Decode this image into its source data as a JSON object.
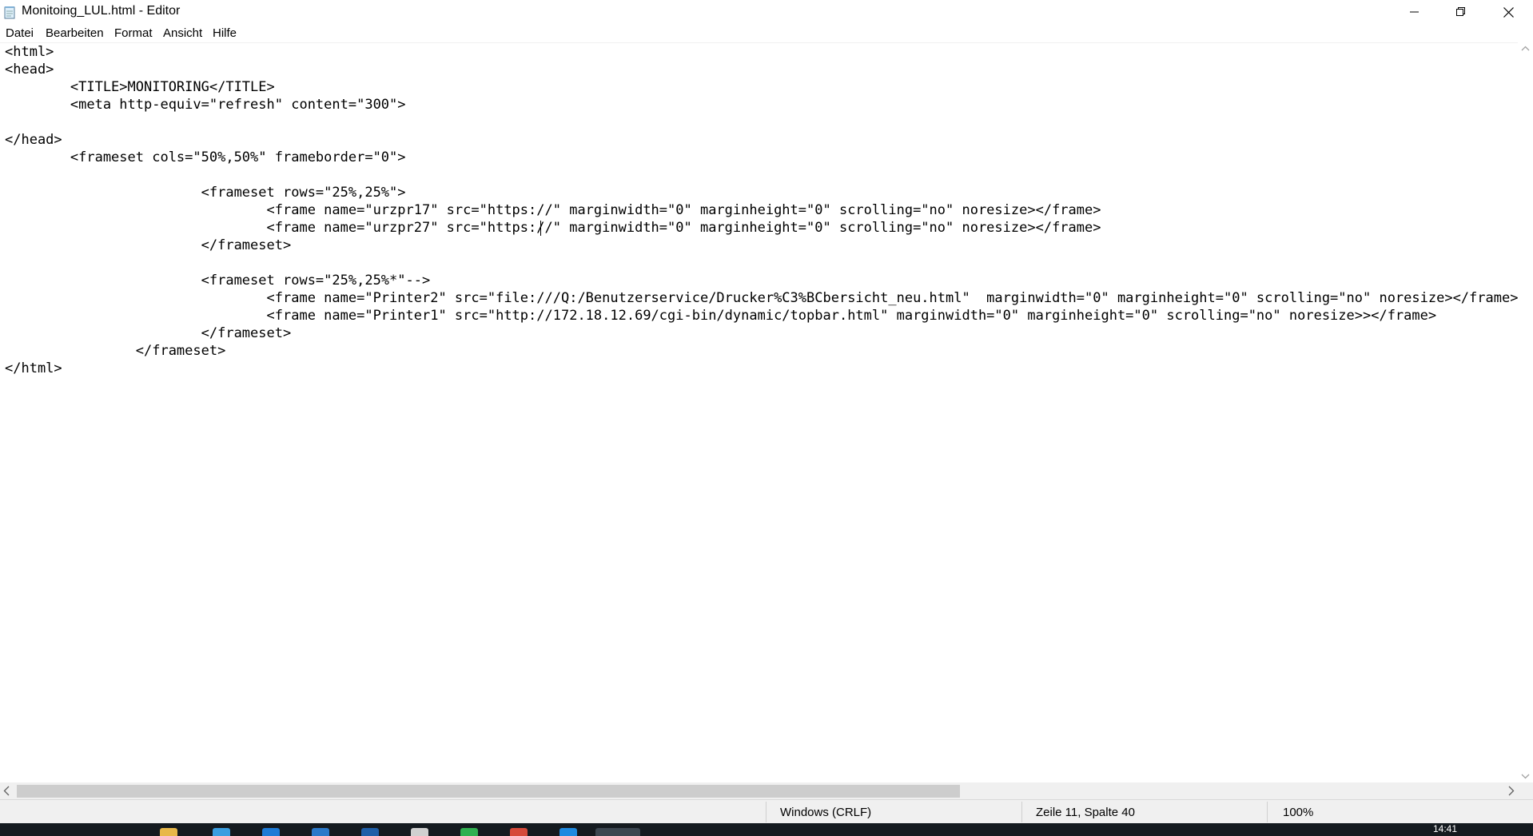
{
  "window": {
    "title": "Monitoing_LUL.html - Editor"
  },
  "menu": {
    "items": [
      "Datei",
      "Bearbeiten",
      "Format",
      "Ansicht",
      "Hilfe"
    ]
  },
  "editor": {
    "lines": [
      "<html>",
      "<head>",
      "        <TITLE>MONITORING</TITLE>",
      "        <meta http-equiv=\"refresh\" content=\"300\">",
      "",
      "</head>",
      "        <frameset cols=\"50%,50%\" frameborder=\"0\">",
      "",
      "                        <frameset rows=\"25%,25%\">",
      "                                <frame name=\"urzpr17\" src=\"https://\" marginwidth=\"0\" marginheight=\"0\" scrolling=\"no\" noresize></frame>",
      "                                <frame name=\"urzpr27\" src=\"https://\" marginwidth=\"0\" marginheight=\"0\" scrolling=\"no\" noresize></frame>",
      "                        </frameset>",
      "",
      "                        <frameset rows=\"25%,25%*\"-->",
      "                                <frame name=\"Printer2\" src=\"file:///Q:/Benutzerservice/Drucker%C3%BCbersicht_neu.html\"  marginwidth=\"0\" marginheight=\"0\" scrolling=\"no\" noresize></frame>",
      "                                <frame name=\"Printer1\" src=\"http://172.18.12.69/cgi-bin/dynamic/topbar.html\" marginwidth=\"0\" marginheight=\"0\" scrolling=\"no\" noresize>></frame>",
      "                        </frameset>",
      "                </frameset>",
      "</html>"
    ]
  },
  "status": {
    "encoding": "Windows (CRLF)",
    "position": "Zeile 11, Spalte 40",
    "zoom": "100%"
  },
  "taskbar": {
    "time": "14:41"
  },
  "icons": {
    "app": "notepad-icon",
    "minimize": "minimize-icon",
    "maximize": "restore-icon",
    "close": "close-icon"
  }
}
